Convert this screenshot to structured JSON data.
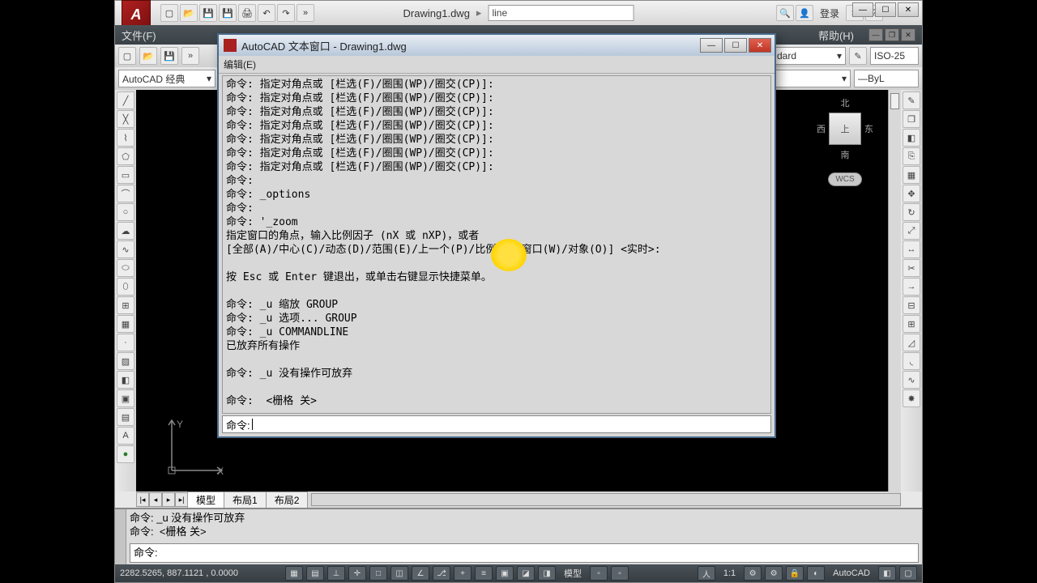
{
  "app": {
    "title": "Drawing1.dwg",
    "search_value": "line",
    "login": "登录"
  },
  "menu": {
    "file": "文件(F)",
    "help": "帮助(H)"
  },
  "toolbar2": {
    "style_combo": "dard",
    "express": "",
    "dim_combo": "ISO-25"
  },
  "workspace": {
    "combo": "AutoCAD 经典",
    "layer_combo": "",
    "color_combo": "ByL"
  },
  "textwin": {
    "title": "AutoCAD 文本窗口 - Drawing1.dwg",
    "edit_menu": "编辑(E)",
    "lines": [
      "命令: 指定对角点或 [栏选(F)/圈围(WP)/圈交(CP)]:",
      "命令: 指定对角点或 [栏选(F)/圈围(WP)/圈交(CP)]:",
      "命令: 指定对角点或 [栏选(F)/圈围(WP)/圈交(CP)]:",
      "命令: 指定对角点或 [栏选(F)/圈围(WP)/圈交(CP)]:",
      "命令: 指定对角点或 [栏选(F)/圈围(WP)/圈交(CP)]:",
      "命令: 指定对角点或 [栏选(F)/圈围(WP)/圈交(CP)]:",
      "命令: 指定对角点或 [栏选(F)/圈围(WP)/圈交(CP)]:",
      "命令:",
      "命令: _options",
      "命令:",
      "命令: '_zoom",
      "指定窗口的角点，输入比例因子 (nX 或 nXP)，或者",
      "[全部(A)/中心(C)/动态(D)/范围(E)/上一个(P)/比例(S)/窗口(W)/对象(O)] <实时>:",
      "",
      "按 Esc 或 Enter 键退出，或单击右键显示快捷菜单。",
      "",
      "命令: _u 缩放 GROUP",
      "命令: _u 选项... GROUP",
      "命令: _u COMMANDLINE",
      "已放弃所有操作",
      "",
      "命令: _u 没有操作可放弃",
      "",
      "命令:  <栅格 关>"
    ],
    "prompt": "命令: "
  },
  "cmd": {
    "hist1": "命令: _u 没有操作可放弃",
    "hist2": "命令:  <栅格 关>",
    "input": "命令: "
  },
  "viewcube": {
    "n": "北",
    "s": "南",
    "e": "东",
    "w": "西",
    "top": "上",
    "wcs": "WCS"
  },
  "tabs": {
    "model": "模型",
    "layout1": "布局1",
    "layout2": "布局2"
  },
  "status": {
    "coords": "2282.5265, 887.1121 , 0.0000",
    "model": "模型",
    "scale": "1:1",
    "autocad": "AutoCAD"
  }
}
